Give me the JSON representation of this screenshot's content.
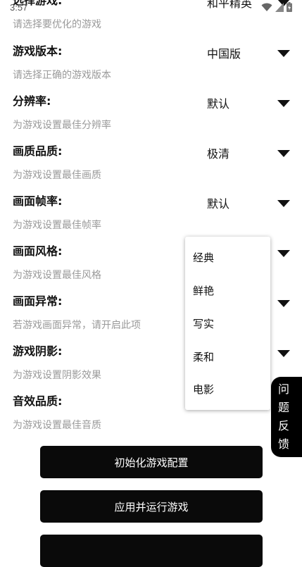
{
  "status": {
    "time": "3:57"
  },
  "settings": [
    {
      "label": "选择游戏:",
      "desc": "请选择要优化的游戏",
      "value": "和平精英"
    },
    {
      "label": "游戏版本:",
      "desc": "请选择正确的游戏版本",
      "value": "中国版"
    },
    {
      "label": "分辨率:",
      "desc": "为游戏设置最佳分辨率",
      "value": "默认"
    },
    {
      "label": "画质品质:",
      "desc": "为游戏设置最佳画质",
      "value": "极清"
    },
    {
      "label": "画面帧率:",
      "desc": "为游戏设置最佳帧率",
      "value": "默认"
    },
    {
      "label": "画面风格:",
      "desc": "为游戏设置最佳风格",
      "value": ""
    },
    {
      "label": "画面异常:",
      "desc": "若游戏画面异常，请开启此项",
      "value": ""
    },
    {
      "label": "游戏阴影:",
      "desc": "为游戏设置阴影效果",
      "value": ""
    },
    {
      "label": "音效品质:",
      "desc": "为游戏设置最佳音质",
      "value": ""
    }
  ],
  "dropdown": {
    "options": [
      "经典",
      "鲜艳",
      "写实",
      "柔和",
      "电影"
    ]
  },
  "buttons": {
    "init": "初始化游戏配置",
    "apply": "应用并运行游戏"
  },
  "feedback": {
    "chars": [
      "问",
      "题",
      "反",
      "馈"
    ]
  },
  "icons": {
    "arrow": "triangle-down-icon",
    "wifi": "wifi-icon",
    "signal": "signal-icon",
    "battery": "battery-charging-icon"
  }
}
